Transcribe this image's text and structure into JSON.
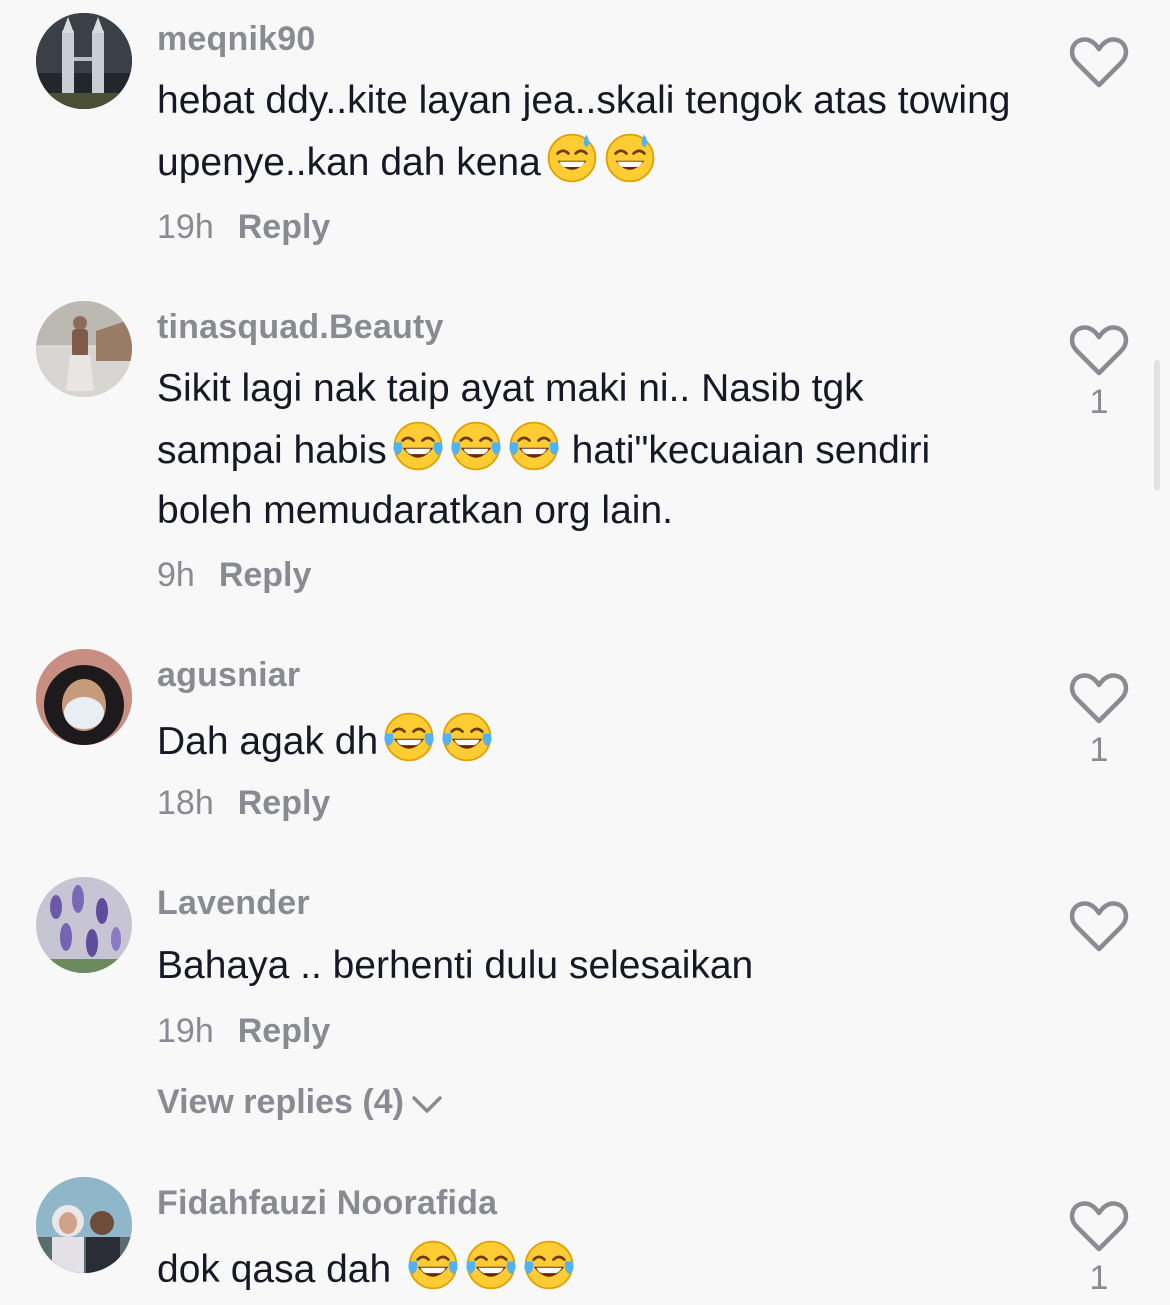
{
  "comments": [
    {
      "username": "meqnik90",
      "text_parts": [
        "hebat ddy..kite layan jea..skali tengok atas towing upenye..kan dah kena"
      ],
      "time": "19h",
      "reply_label": "Reply",
      "likes": "",
      "emoji": "grinning-sweat"
    },
    {
      "username": "tinasquad.Beauty",
      "text_line1": "Sikit lagi nak taip ayat maki ni.. Nasib tgk",
      "text_line2a": "sampai habis",
      "text_line2b": " hati\"kecuaian sendiri",
      "text_line3": "boleh memudaratkan org lain.",
      "time": "9h",
      "reply_label": "Reply",
      "likes": "1",
      "emoji": "tears-of-joy"
    },
    {
      "username": "agusniar",
      "text": "Dah agak dh",
      "time": "18h",
      "reply_label": "Reply",
      "likes": "1",
      "emoji": "tears-of-joy"
    },
    {
      "username": "Lavender",
      "text": "Bahaya .. berhenti dulu selesaikan",
      "time": "19h",
      "reply_label": "Reply",
      "likes": "",
      "view_replies": "View replies (4)"
    },
    {
      "username": "Fidahfauzi Noorafida",
      "text": "dok qasa dah ",
      "likes": "1",
      "emoji": "tears-of-joy"
    }
  ],
  "colors": {
    "background": "#f8f8f8",
    "primary_text": "#161823",
    "secondary_text": "#8a8b91"
  }
}
